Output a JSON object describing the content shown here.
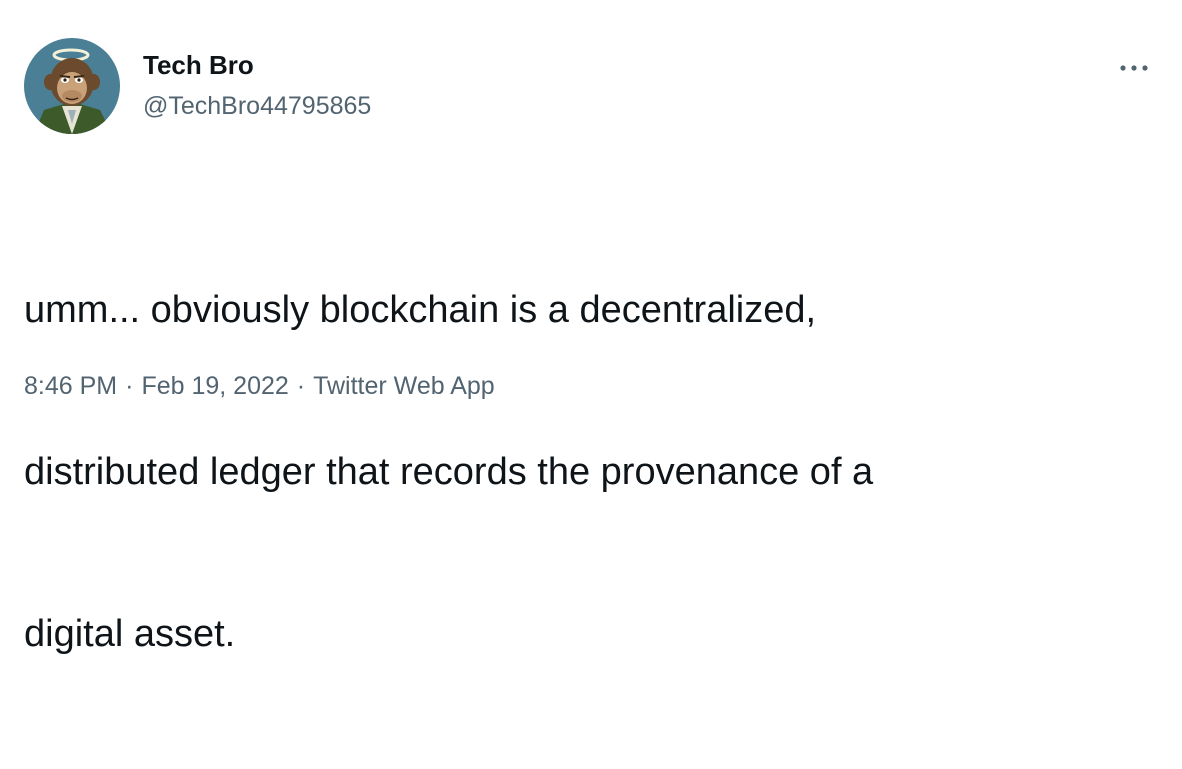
{
  "author": {
    "display_name": "Tech Bro",
    "handle": "@TechBro44795865",
    "avatar_icon": "ape-with-halo-avatar"
  },
  "menu": {
    "more_icon": "ellipsis-icon"
  },
  "tweet": {
    "line1": "umm... obviously blockchain is a decentralized,",
    "line2": "distributed ledger that records the provenance of a",
    "line3": "digital asset."
  },
  "meta": {
    "time": "8:46 PM",
    "separator": "·",
    "date": "Feb 19, 2022",
    "source": "Twitter Web App"
  },
  "colors": {
    "text": "#0f1419",
    "secondary": "#536471",
    "background": "#ffffff"
  }
}
